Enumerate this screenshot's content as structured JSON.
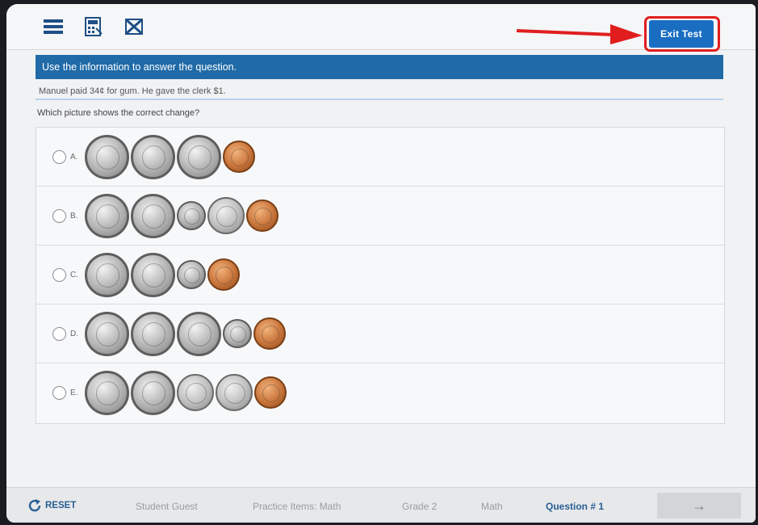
{
  "toolbar": {
    "icons": [
      "menu-icon",
      "calculator-icon",
      "strikethrough-icon"
    ],
    "exit_label": "Exit Test"
  },
  "question": {
    "banner": "Use the information to answer the question.",
    "context": "Manuel paid 34¢ for gum. He gave the clerk $1.",
    "prompt": "Which picture shows the correct change?",
    "choices": [
      {
        "letter": "A.",
        "coins": [
          "quarter",
          "quarter",
          "quarter",
          "penny"
        ]
      },
      {
        "letter": "B.",
        "coins": [
          "quarter",
          "quarter",
          "dime",
          "nickel",
          "penny"
        ]
      },
      {
        "letter": "C.",
        "coins": [
          "quarter",
          "quarter",
          "dime",
          "penny"
        ]
      },
      {
        "letter": "D.",
        "coins": [
          "quarter",
          "quarter",
          "quarter",
          "dime",
          "penny"
        ]
      },
      {
        "letter": "E.",
        "coins": [
          "quarter",
          "quarter",
          "nickel",
          "nickel",
          "penny"
        ]
      }
    ]
  },
  "footer": {
    "reset_label": "RESET",
    "student": "Student Guest",
    "test_name": "Practice Items: Math",
    "grade": "Grade 2",
    "subject": "Math",
    "question_label": "Question # 1",
    "next_icon": "→"
  },
  "colors": {
    "banner": "#1f6aa7",
    "exit_button": "#1a6ec2",
    "highlight": "#e01e1e",
    "active_footer": "#2a5f95"
  }
}
